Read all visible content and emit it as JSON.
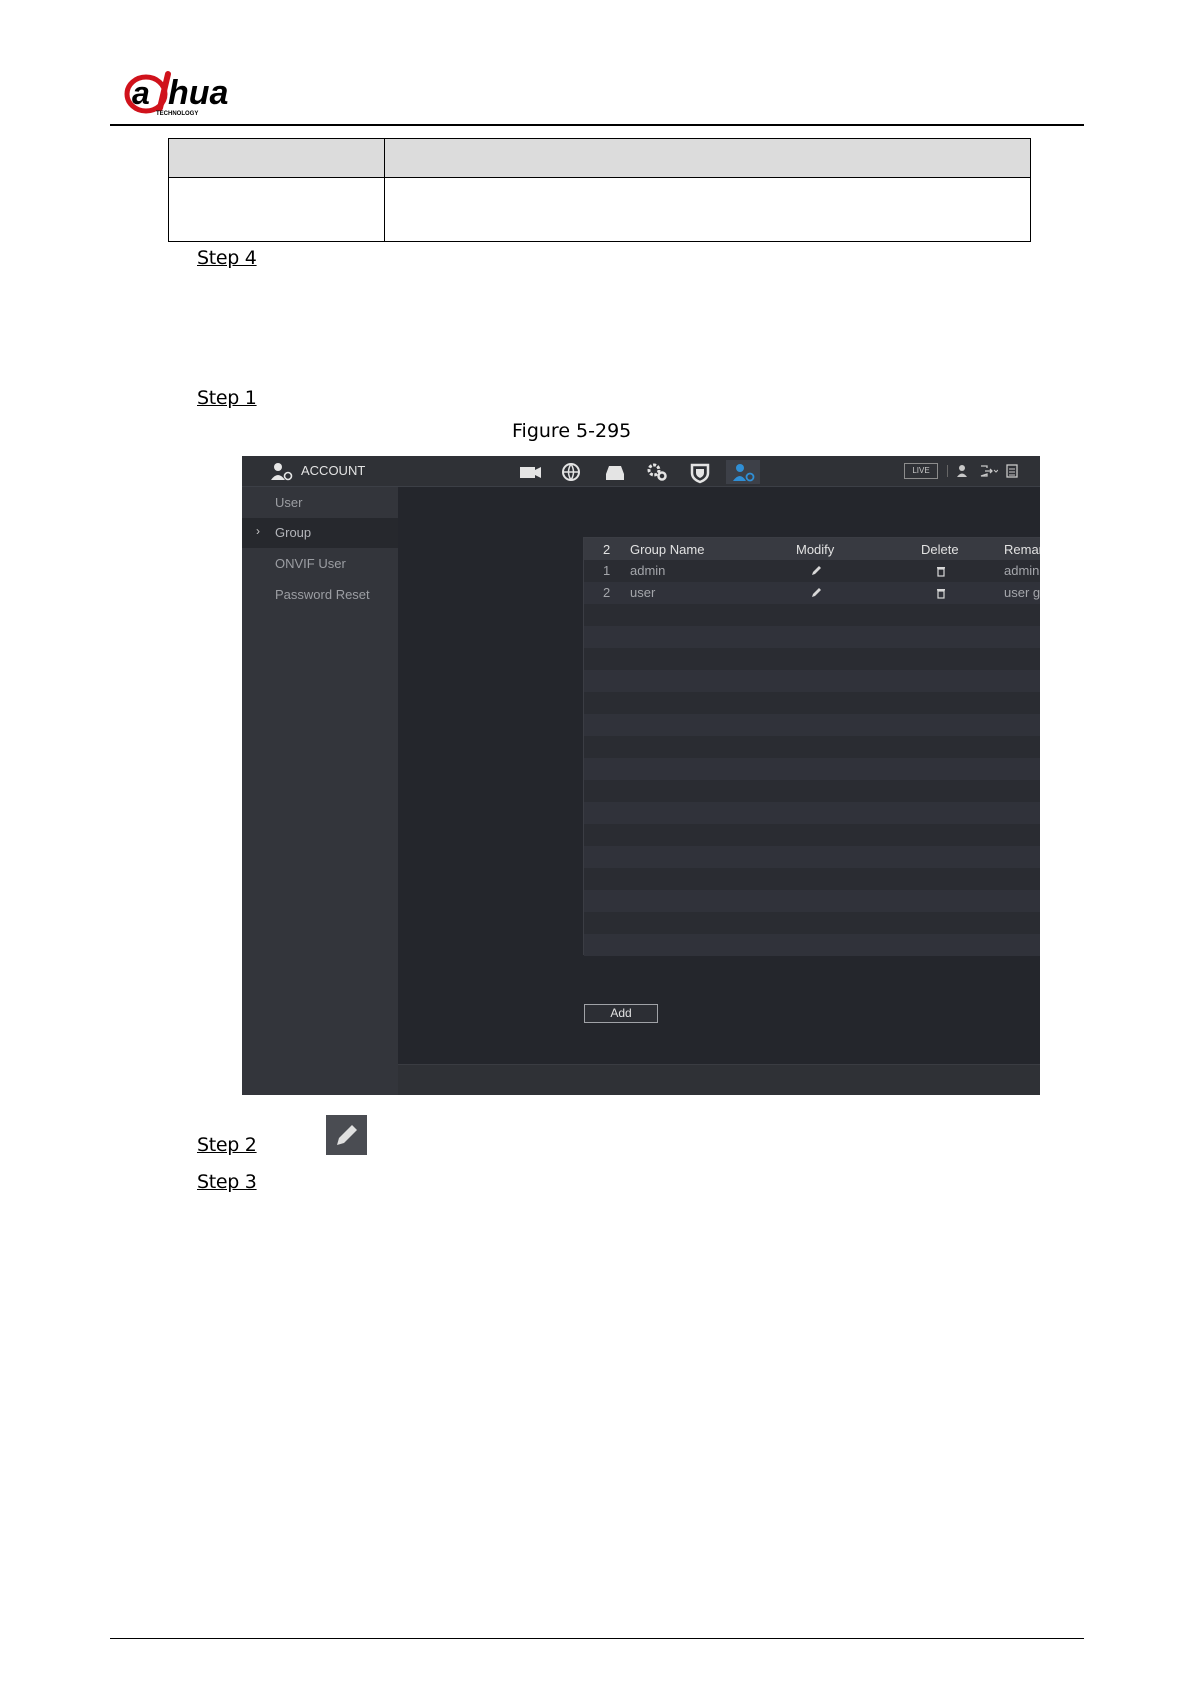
{
  "brand": {
    "logo_text": "alhua",
    "logo_subtext": "TECHNOLOGY"
  },
  "steps": {
    "step4": "Step 4",
    "step1": "Step 1",
    "step2": "Step 2",
    "step3": "Step 3"
  },
  "figure_caption": "Figure 5-295",
  "ui": {
    "title": "ACCOUNT",
    "live_label": "LIVE",
    "sidebar": [
      {
        "label": "User",
        "active": false
      },
      {
        "label": "Group",
        "active": true
      },
      {
        "label": "ONVIF User",
        "active": false
      },
      {
        "label": "Password Reset",
        "active": false
      }
    ],
    "table": {
      "headers": {
        "count": "2",
        "name": "Group Name",
        "modify": "Modify",
        "delete": "Delete",
        "remarks": "Remarks"
      },
      "rows": [
        {
          "index": "1",
          "name": "admin",
          "remarks": "administrator group"
        },
        {
          "index": "2",
          "name": "user",
          "remarks": "user group"
        }
      ]
    },
    "add_label": "Add",
    "colors": {
      "accent": "#2f8fd6",
      "panel": "#24262c",
      "sidebar": "#33353b"
    }
  }
}
